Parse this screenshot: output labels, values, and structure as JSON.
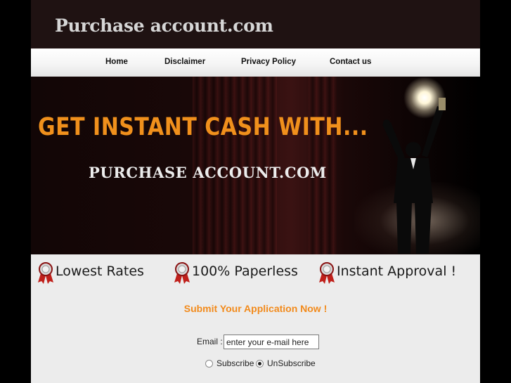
{
  "header": {
    "logo_text": "Purchase account.com"
  },
  "nav": {
    "items": [
      {
        "label": "Home"
      },
      {
        "label": "Disclaimer"
      },
      {
        "label": "Privacy Policy"
      },
      {
        "label": "Contact us"
      }
    ]
  },
  "banner": {
    "headline": "GET INSTANT CASH WITH...",
    "subline": "PURCHASE ACCOUNT.COM"
  },
  "features": [
    {
      "label": "Lowest Rates",
      "icon": "award-ribbon-icon"
    },
    {
      "label": "100% Paperless",
      "icon": "award-ribbon-icon"
    },
    {
      "label": "Instant Approval !",
      "icon": "award-ribbon-icon"
    }
  ],
  "form": {
    "title": "Submit Your Application Now !",
    "email_label": "Email :",
    "email_placeholder": "enter your e-mail here",
    "options": [
      {
        "label": "Subscribe",
        "checked": false
      },
      {
        "label": "UnSubscribe",
        "checked": true
      }
    ]
  },
  "colors": {
    "accent_orange": "#f28a1b",
    "header_bg": "#1f1212",
    "ribbon_red": "#c0201b"
  }
}
